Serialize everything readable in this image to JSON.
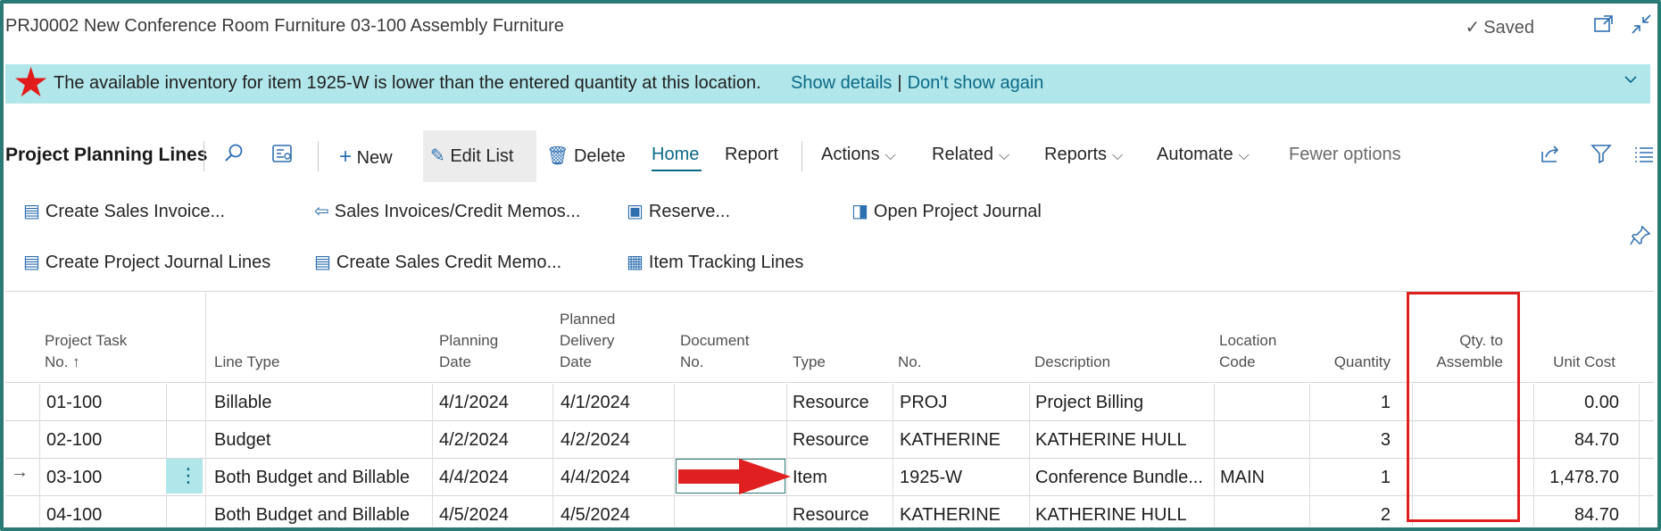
{
  "window": {
    "title": "PRJ0002 New Conference Room Furniture 03-100 Assembly Furniture",
    "saved_label": "Saved"
  },
  "notification": {
    "message": "The available inventory for item 1925-W is lower than the entered quantity at this location.",
    "show_details": "Show details",
    "separator": "|",
    "dont_show": "Don't show again",
    "icon": "star-icon",
    "star_color": "#e21b1b"
  },
  "actionbar": {
    "page_title": "Project Planning Lines",
    "new": "New",
    "edit_list": "Edit List",
    "delete": "Delete",
    "home": "Home",
    "report": "Report",
    "actions": "Actions",
    "related": "Related",
    "reports": "Reports",
    "automate": "Automate",
    "fewer_options": "Fewer options"
  },
  "promoted": {
    "create_sales_invoice": "Create Sales Invoice...",
    "sales_invoices_credit_memos": "Sales Invoices/Credit Memos...",
    "reserve": "Reserve...",
    "open_project_journal": "Open Project Journal",
    "create_project_journal_lines": "Create Project Journal Lines",
    "create_sales_credit_memo": "Create Sales Credit Memo...",
    "item_tracking_lines": "Item Tracking Lines"
  },
  "grid": {
    "headers": {
      "task_no_1": "Project Task",
      "task_no_2": "No. ↑",
      "line_type": "Line Type",
      "planning_1": "Planning",
      "planning_2": "Date",
      "planned_1": "Planned",
      "planned_2": "Delivery",
      "planned_3": "Date",
      "doc_1": "Document",
      "doc_2": "No.",
      "type": "Type",
      "no": "No.",
      "description": "Description",
      "loc_1": "Location",
      "loc_2": "Code",
      "quantity": "Quantity",
      "qta_1": "Qty. to",
      "qta_2": "Assemble",
      "unit_cost": "Unit Cost"
    },
    "rows": [
      {
        "task": "01-100",
        "line_type": "Billable",
        "planning_date": "4/1/2024",
        "delivery_date": "4/1/2024",
        "type": "Resource",
        "no": "PROJ",
        "description": "Project Billing",
        "location": "",
        "quantity": "1",
        "unit_cost": "0.00"
      },
      {
        "task": "02-100",
        "line_type": "Budget",
        "planning_date": "4/2/2024",
        "delivery_date": "4/2/2024",
        "type": "Resource",
        "no": "KATHERINE",
        "description": "KATHERINE HULL",
        "location": "",
        "quantity": "3",
        "unit_cost": "84.70"
      },
      {
        "task": "03-100",
        "line_type": "Both Budget and Billable",
        "planning_date": "4/4/2024",
        "delivery_date": "4/4/2024",
        "type": "Item",
        "no": "1925-W",
        "description": "Conference Bundle...",
        "location": "MAIN",
        "quantity": "1",
        "unit_cost": "1,478.70"
      },
      {
        "task": "04-100",
        "line_type": "Both Budget and Billable",
        "planning_date": "4/5/2024",
        "delivery_date": "4/5/2024",
        "type": "Resource",
        "no": "KATHERINE",
        "description": "KATHERINE HULL",
        "location": "",
        "quantity": "2",
        "unit_cost": "84.70"
      }
    ],
    "row_menu_glyph": "⋮",
    "current_row_glyph": "→"
  }
}
